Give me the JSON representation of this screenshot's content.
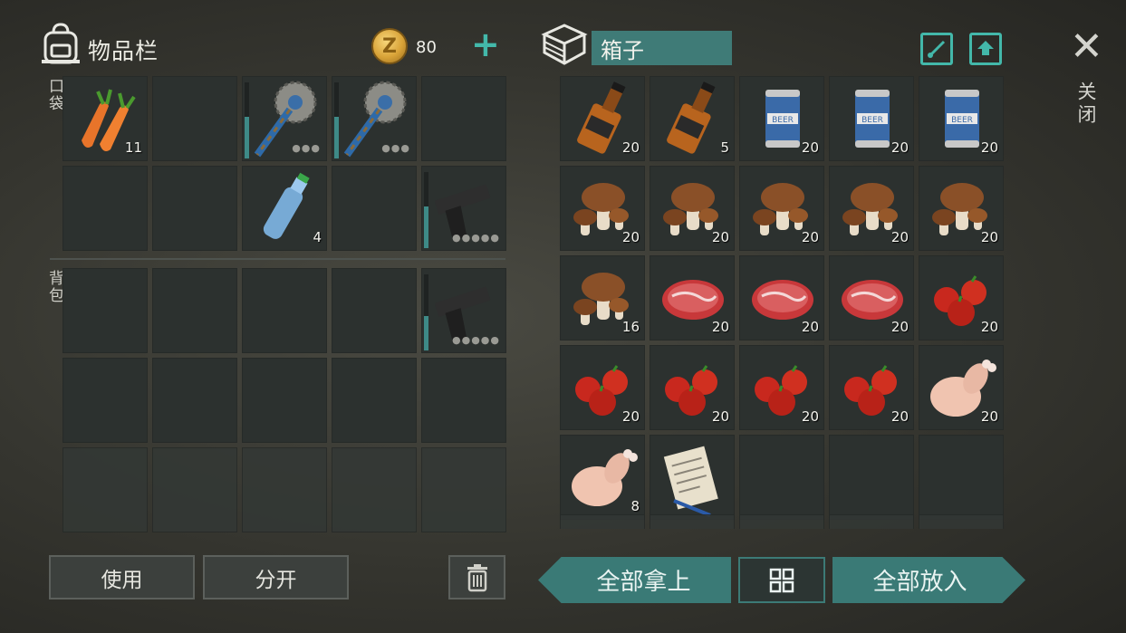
{
  "inventory": {
    "title": "物品栏",
    "coin_symbol": "Z",
    "coins": "80",
    "plus": "+",
    "pocket_label": "口袋",
    "backpack_label": "背包",
    "pocket": [
      {
        "icon": "carrot",
        "count": "11"
      },
      {
        "icon": "empty",
        "count": ""
      },
      {
        "icon": "saw-mace",
        "count": "",
        "durability": 0.55,
        "dots": "●●●"
      },
      {
        "icon": "saw-mace",
        "count": "",
        "durability": 0.55,
        "dots": "●●●"
      },
      {
        "icon": "empty",
        "count": ""
      },
      {
        "icon": "empty",
        "count": ""
      },
      {
        "icon": "empty",
        "count": ""
      },
      {
        "icon": "water-bottle",
        "count": "4"
      },
      {
        "icon": "empty",
        "count": ""
      },
      {
        "icon": "pistol",
        "count": "",
        "durability": 0.55,
        "dots": "●●●●●"
      }
    ],
    "backpack": [
      {
        "icon": "empty"
      },
      {
        "icon": "empty"
      },
      {
        "icon": "empty"
      },
      {
        "icon": "empty"
      },
      {
        "icon": "pistol",
        "durability": 0.45,
        "dots": "●●●●●"
      },
      {
        "icon": "empty"
      },
      {
        "icon": "empty"
      },
      {
        "icon": "empty"
      },
      {
        "icon": "empty"
      },
      {
        "icon": "empty"
      }
    ]
  },
  "container": {
    "name": "箱子",
    "items": [
      {
        "icon": "whiskey",
        "count": "20"
      },
      {
        "icon": "whiskey",
        "count": "5"
      },
      {
        "icon": "beer",
        "count": "20"
      },
      {
        "icon": "beer",
        "count": "20"
      },
      {
        "icon": "beer",
        "count": "20"
      },
      {
        "icon": "mushroom",
        "count": "20"
      },
      {
        "icon": "mushroom",
        "count": "20"
      },
      {
        "icon": "mushroom",
        "count": "20"
      },
      {
        "icon": "mushroom",
        "count": "20"
      },
      {
        "icon": "mushroom",
        "count": "20"
      },
      {
        "icon": "mushroom",
        "count": "16"
      },
      {
        "icon": "steak",
        "count": "20"
      },
      {
        "icon": "steak",
        "count": "20"
      },
      {
        "icon": "steak",
        "count": "20"
      },
      {
        "icon": "tomato",
        "count": "20"
      },
      {
        "icon": "tomato",
        "count": "20"
      },
      {
        "icon": "tomato",
        "count": "20"
      },
      {
        "icon": "tomato",
        "count": "20"
      },
      {
        "icon": "tomato",
        "count": "20"
      },
      {
        "icon": "chicken",
        "count": "20"
      },
      {
        "icon": "chicken",
        "count": "8"
      },
      {
        "icon": "notes",
        "count": ""
      },
      {
        "icon": "empty",
        "count": ""
      },
      {
        "icon": "empty",
        "count": ""
      },
      {
        "icon": "empty",
        "count": ""
      }
    ]
  },
  "buttons": {
    "use": "使用",
    "split": "分开",
    "take_all": "全部拿上",
    "put_all": "全部放入"
  },
  "close_label": "关闭",
  "colors": {
    "accent": "#43b8aa",
    "teal_button": "#3a7a76",
    "slot": "#2c312f"
  }
}
